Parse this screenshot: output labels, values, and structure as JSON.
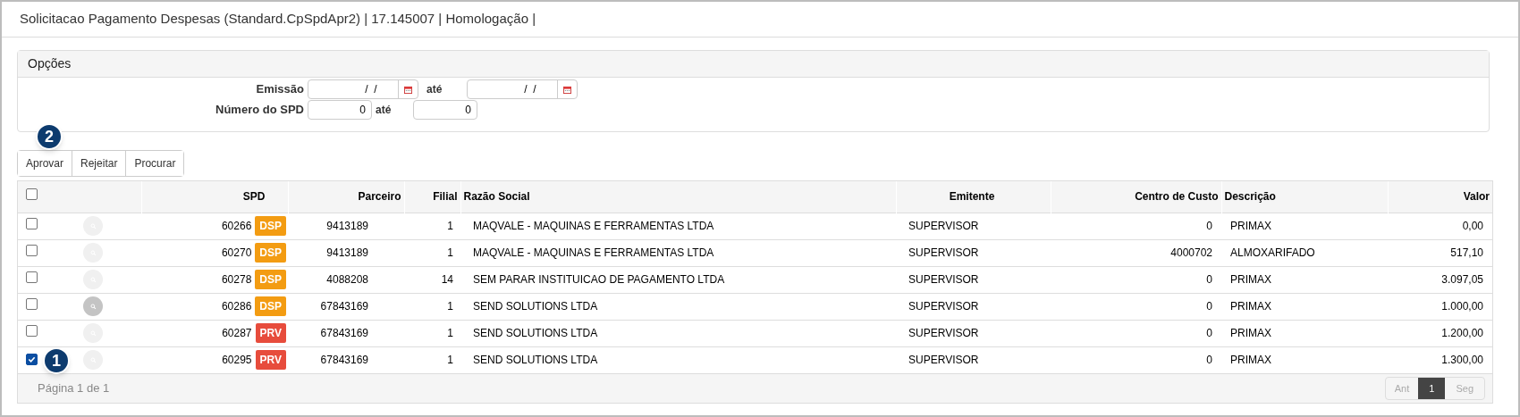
{
  "window": {
    "title": "Solicitacao Pagamento Despesas (Standard.CpSpdApr2) | 17.145007 | Homologação |"
  },
  "options": {
    "title": "Opções",
    "fields": [
      {
        "label": "Emissão",
        "kind": "date",
        "from": " /  / ",
        "to_label": "até",
        "to": " /  / "
      },
      {
        "label": "Número do SPD",
        "kind": "number",
        "from": "0",
        "to_label": "até",
        "to": "0"
      }
    ]
  },
  "toolbar": {
    "buttons": [
      "Aprovar",
      "Rejeitar",
      "Procurar"
    ]
  },
  "table": {
    "select_all": {
      "checked": false
    },
    "columns": [
      "SPD",
      "Parceiro",
      "Filial",
      "Razão Social",
      "Emitente",
      "Centro de Custo",
      "Descrição",
      "Valor"
    ],
    "rows": [
      {
        "checked": false,
        "highlighted": false,
        "spd": "60266",
        "tag": "DSP",
        "color": "#f39c12",
        "parceiro": "9413189",
        "filial": "1",
        "razao": "MAQVALE - MAQUINAS E FERRAMENTAS LTDA",
        "emitente": "SUPERVISOR",
        "centro": "0",
        "descricao": "PRIMAX",
        "valor": "0,00"
      },
      {
        "checked": false,
        "highlighted": false,
        "spd": "60270",
        "tag": "DSP",
        "color": "#f39c12",
        "parceiro": "9413189",
        "filial": "1",
        "razao": "MAQVALE - MAQUINAS E FERRAMENTAS LTDA",
        "emitente": "SUPERVISOR",
        "centro": "4000702",
        "descricao": "ALMOXARIFADO",
        "valor": "517,10"
      },
      {
        "checked": false,
        "highlighted": false,
        "spd": "60278",
        "tag": "DSP",
        "color": "#f39c12",
        "parceiro": "4088208",
        "filial": "14",
        "razao": "SEM PARAR INSTITUICAO DE PAGAMENTO LTDA",
        "emitente": "SUPERVISOR",
        "centro": "0",
        "descricao": "PRIMAX",
        "valor": "3.097,05"
      },
      {
        "checked": false,
        "highlighted": true,
        "spd": "60286",
        "tag": "DSP",
        "color": "#f39c12",
        "parceiro": "67843169",
        "filial": "1",
        "razao": "SEND SOLUTIONS LTDA",
        "emitente": "SUPERVISOR",
        "centro": "0",
        "descricao": "PRIMAX",
        "valor": "1.000,00"
      },
      {
        "checked": false,
        "highlighted": false,
        "spd": "60287",
        "tag": "PRV",
        "color": "#e74c3c",
        "parceiro": "67843169",
        "filial": "1",
        "razao": "SEND SOLUTIONS LTDA",
        "emitente": "SUPERVISOR",
        "centro": "0",
        "descricao": "PRIMAX",
        "valor": "1.200,00"
      },
      {
        "checked": true,
        "highlighted": false,
        "spd": "60295",
        "tag": "PRV",
        "color": "#e74c3c",
        "parceiro": "67843169",
        "filial": "1",
        "razao": "SEND SOLUTIONS LTDA",
        "emitente": "SUPERVISOR",
        "centro": "0",
        "descricao": "PRIMAX",
        "valor": "1.300,00"
      }
    ]
  },
  "pagination": {
    "label": "Página 1 de 1",
    "prev": "Ant",
    "pages": [
      {
        "label": "1",
        "selected": true
      }
    ],
    "next": "Seg"
  },
  "annotations": [
    "2",
    "1"
  ]
}
